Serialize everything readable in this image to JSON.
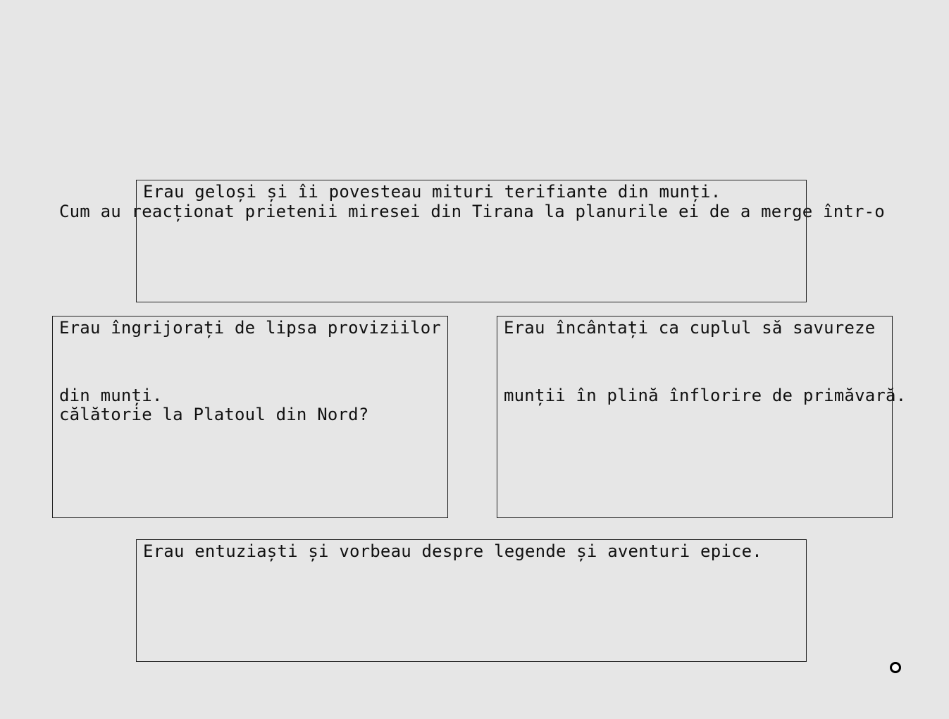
{
  "question": {
    "line1": "Cum au reacționat prietenii miresei din Tirana la planurile ei de a merge într-o",
    "line2": "călătorie la Platoul din Nord?"
  },
  "answers": [
    {
      "id": "a",
      "lines": [
        "Erau geloși și îi povesteau mituri terifiante din munți."
      ]
    },
    {
      "id": "b",
      "lines": [
        "Erau îngrijorați de lipsa proviziilor",
        "din munți."
      ]
    },
    {
      "id": "c",
      "lines": [
        "Erau încântați ca cuplul să savureze",
        "munții în plină înflorire de primăvară."
      ]
    },
    {
      "id": "d",
      "lines": [
        "Erau entuziaști și vorbeau despre legende și aventuri epice."
      ]
    }
  ],
  "indicator": {
    "icon": "ring-icon"
  }
}
